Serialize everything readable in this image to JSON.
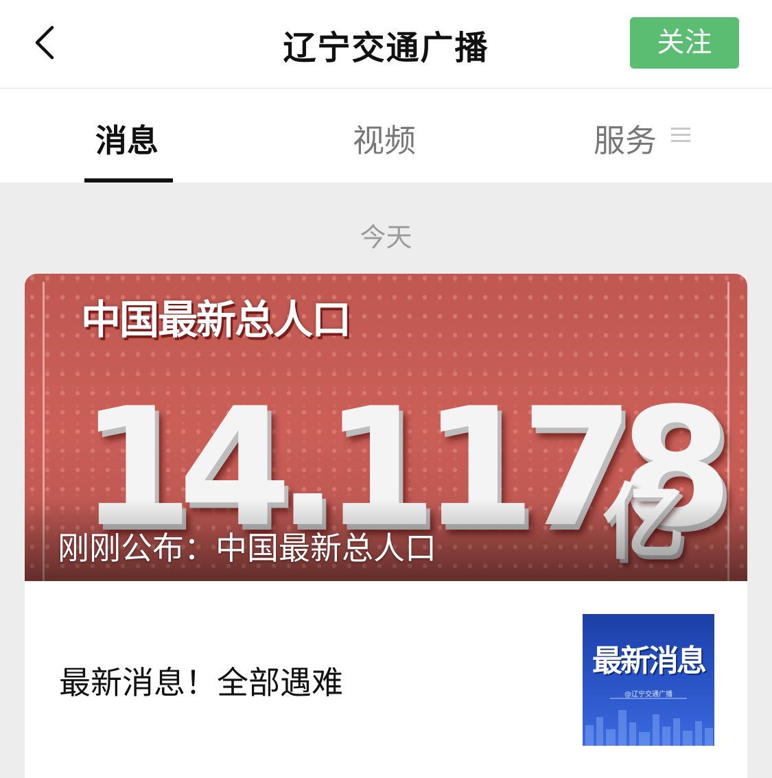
{
  "header": {
    "back_icon": "chevron-left-icon",
    "title": "辽宁交通广播",
    "follow_label": "关注",
    "follow_color": "#5bbd72"
  },
  "tabs": {
    "items": [
      {
        "label": "消息",
        "active": true
      },
      {
        "label": "视频",
        "active": false
      },
      {
        "label": "服务",
        "active": false
      }
    ],
    "menu_icon": "menu-lines-icon"
  },
  "feed": {
    "date_label": "今天",
    "card": {
      "cover": {
        "heading": "中国最新总人口",
        "number": "14.1178",
        "unit": "亿",
        "caption": "刚刚公布：中国最新总人口"
      },
      "article": {
        "title": "最新消息！全部遇难",
        "thumb_title": "最新消息",
        "thumb_sub": "@辽宁交通广播"
      }
    }
  }
}
